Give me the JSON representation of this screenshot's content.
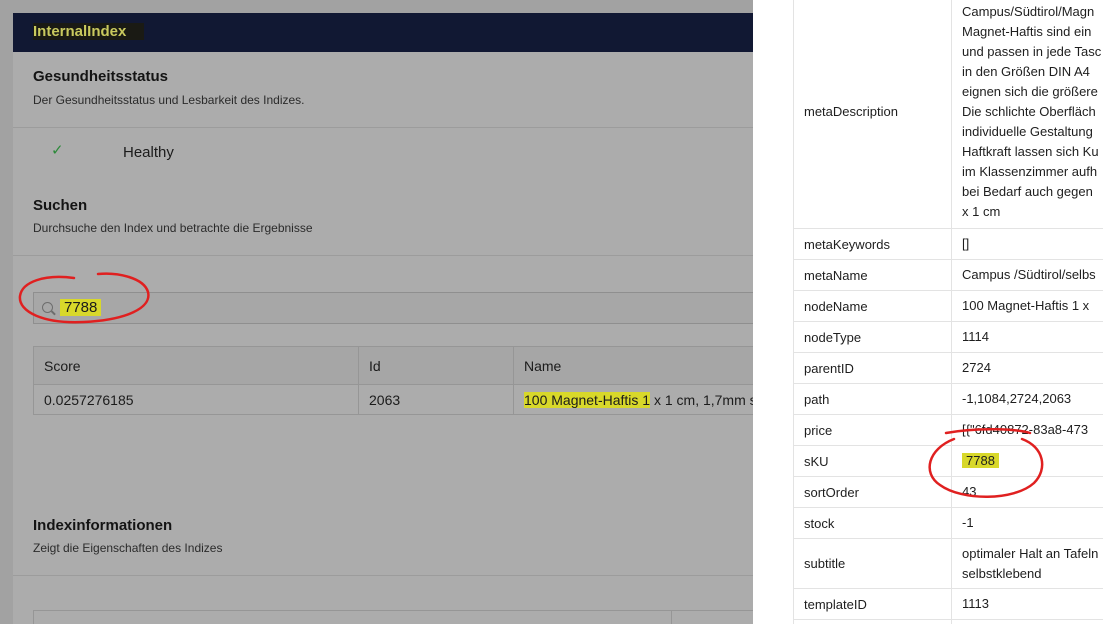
{
  "index_card": {
    "title": "InternalIndex",
    "health": {
      "title": "Gesundheitsstatus",
      "subtitle": "Der Gesundheitsstatus und Lesbarkeit des Indizes.",
      "status": "Healthy"
    },
    "search": {
      "title": "Suchen",
      "subtitle": "Durchsuche den Index und betrachte die Ergebnisse",
      "query": "7788",
      "columns": [
        "Score",
        "Id",
        "Name"
      ],
      "result": {
        "score": "0.0257276185",
        "id": "2063",
        "name_highlight": "100 Magnet-Haftis 1",
        "name_rest": " x 1 cm, 1,7mm s"
      }
    },
    "info": {
      "title": "Indexinformationen",
      "subtitle": "Zeigt die Eigenschaften des Indizes"
    }
  },
  "details": {
    "metaDescription": {
      "key": "metaDescription",
      "lines": [
        "Campus/Südtirol/Magn",
        "Magnet-Haftis sind ein",
        "und passen in jede Tasc",
        "in den Größen DIN A4",
        "eignen sich die größere",
        "Die schlichte Oberfläch",
        "individuelle Gestaltung",
        "Haftkraft lassen sich Ku",
        "im Klassenzimmer aufh",
        "bei Bedarf auch gegen",
        "x 1 cm"
      ]
    },
    "rows": [
      {
        "key": "metaKeywords",
        "value": "[]"
      },
      {
        "key": "metaName",
        "value": "Campus /Südtirol/selbs"
      },
      {
        "key": "nodeName",
        "value": "100 Magnet-Haftis 1 x"
      },
      {
        "key": "nodeType",
        "value": "1114"
      },
      {
        "key": "parentID",
        "value": "2724"
      },
      {
        "key": "path",
        "value": "-1,1084,2724,2063"
      },
      {
        "key": "price",
        "value": "[{\"6fd40872-83a8-473"
      },
      {
        "key": "sKU",
        "value": "7788"
      },
      {
        "key": "sortOrder",
        "value": "43"
      },
      {
        "key": "stock",
        "value": "-1"
      },
      {
        "key": "subtitle",
        "value": "optimaler Halt an Tafeln"
      },
      {
        "key": "subtitle_line2",
        "value": "selbstklebend"
      },
      {
        "key": "templateID",
        "value": "1113"
      }
    ]
  }
}
